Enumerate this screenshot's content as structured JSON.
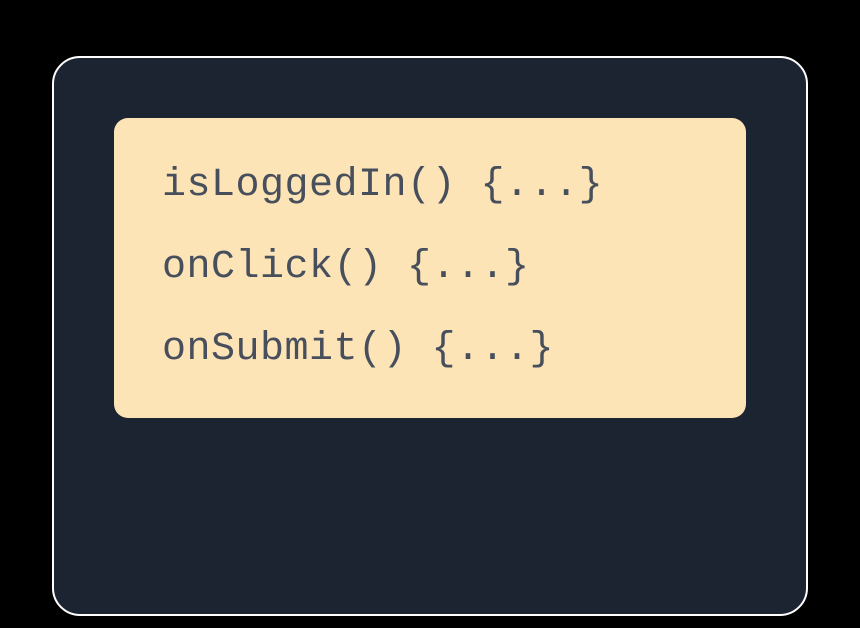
{
  "code": {
    "lines": [
      "isLoggedIn() {...}",
      "onClick() {...}",
      "onSubmit() {...}"
    ]
  },
  "colors": {
    "page_bg": "#000000",
    "panel_bg": "#1d2431",
    "panel_border": "#ffffff",
    "box_bg": "#fde4b7",
    "text": "#474e5c"
  }
}
